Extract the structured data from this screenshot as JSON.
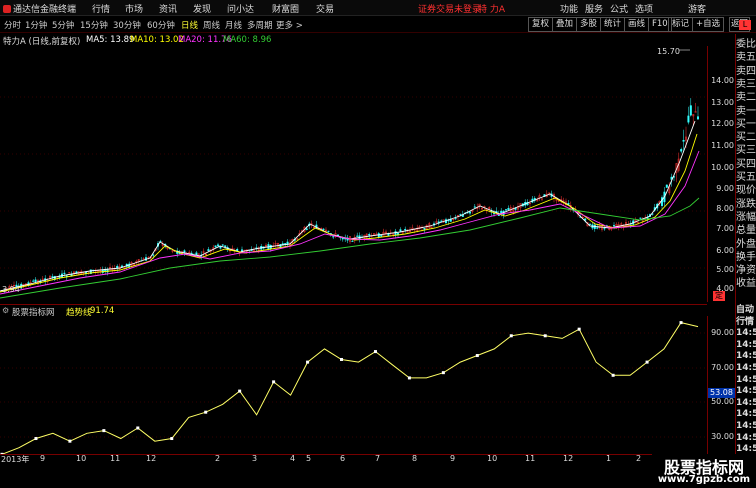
{
  "menubar": {
    "app_title": "通达信金融终端",
    "items": [
      "行情",
      "市场",
      "资讯",
      "发现",
      "问小达",
      "财富圈",
      "交易"
    ],
    "notice": "证券交易未登录",
    "stock_name": "特 力A",
    "right_items": [
      "功能",
      "服务",
      "公式",
      "选项"
    ],
    "guest": "游客"
  },
  "periodbar": {
    "periods": [
      "分时",
      "1分钟",
      "5分钟",
      "15分钟",
      "30分钟",
      "60分钟",
      "日线",
      "周线",
      "月线",
      "多周期",
      "更多 >"
    ],
    "active": "日线",
    "tools": [
      "复权",
      "叠加",
      "多股",
      "统计",
      "画线",
      "F10",
      "标记",
      "+自选",
      "返回"
    ]
  },
  "chart_header": {
    "title": "特力A (日线,前复权)",
    "ma5": "MA5: 13.89",
    "ma10": "MA10: 13.02",
    "ma20": "MA20: 11.76",
    "ma60": "MA60: 8.96",
    "high_label": "15.70",
    "low_label": "3.94"
  },
  "main_yaxis": [
    "14.00",
    "13.00",
    "12.00",
    "11.00",
    "10.00",
    "9.00",
    "8.00",
    "7.00",
    "6.00",
    "5.00",
    "4.00"
  ],
  "indicator": {
    "source": "股票指标网",
    "name": "趋势线",
    "value": "91.74",
    "yaxis": [
      "90.00",
      "70.00",
      "50.00",
      "30.00"
    ],
    "current_tag": "53.08"
  },
  "xaxis": [
    "2013年",
    "9",
    "10",
    "11",
    "12",
    "2",
    "3",
    "4",
    "5",
    "6",
    "7",
    "8",
    "9",
    "10",
    "11",
    "12",
    "1",
    "2"
  ],
  "sidebar": {
    "top": [
      "委比",
      "卖五",
      "卖四",
      "卖三",
      "卖二",
      "卖一",
      "买一",
      "买二",
      "买三",
      "买四",
      "买五",
      "现价",
      "涨跌",
      "涨幅",
      "总量",
      "外盘",
      "换手",
      "净资",
      "收益"
    ],
    "bottom": [
      "自动",
      "行情",
      "14:5",
      "14:5",
      "14:5",
      "14:5",
      "14:5",
      "14:5",
      "14:5",
      "14:5",
      "14:5",
      "14:5",
      "14:5"
    ]
  },
  "watermark": {
    "cn": "股票指标网",
    "url": "www.7gpzb.com"
  },
  "colors": {
    "ma5": "#ffffff",
    "ma10": "#ffff00",
    "ma20": "#ff33ff",
    "ma60": "#33cc33",
    "up": "#ff3333",
    "down": "#33ffff",
    "axis": "#770000",
    "indicator_line": "#ffff66"
  },
  "chart_data": {
    "type": "line",
    "series": [
      {
        "name": "趋势线",
        "values": [
          0,
          5,
          12,
          16,
          10,
          16,
          18,
          12,
          20,
          10,
          12,
          28,
          32,
          38,
          48,
          30,
          55,
          45,
          70,
          80,
          72,
          70,
          78,
          68,
          58,
          58,
          62,
          70,
          75,
          80,
          90,
          92,
          90,
          88,
          95,
          70,
          60,
          60,
          70,
          80,
          100,
          97
        ]
      }
    ],
    "ylim": [
      20,
      100
    ]
  }
}
